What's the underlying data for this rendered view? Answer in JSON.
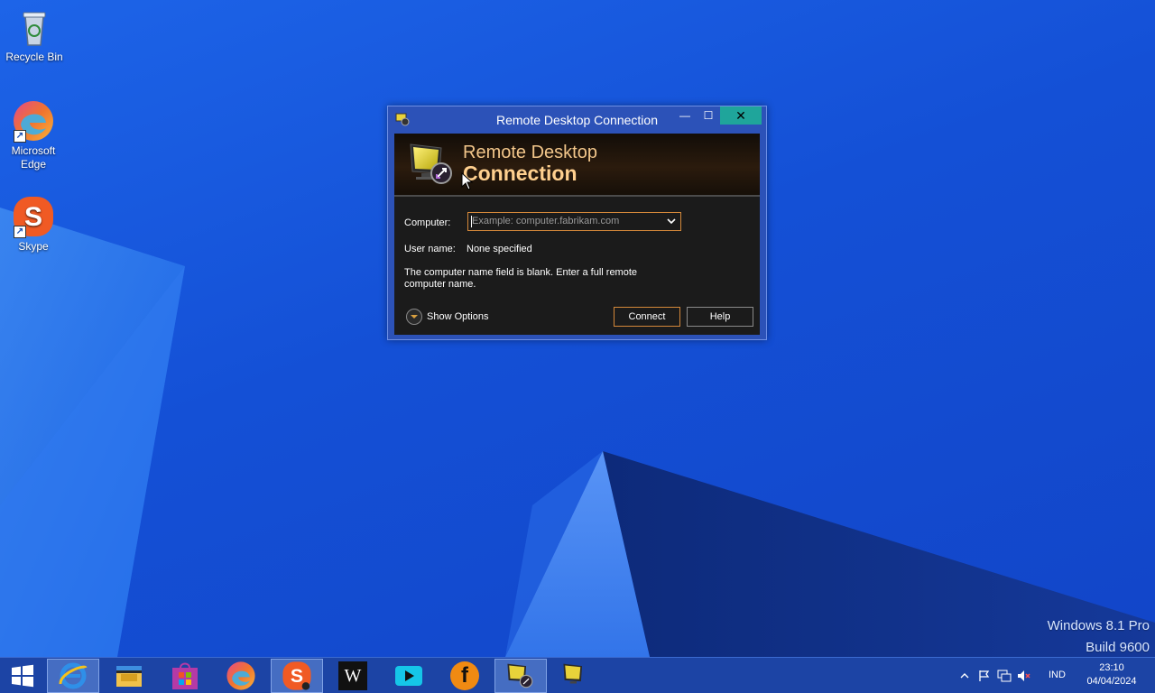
{
  "desktop": {
    "icons": [
      {
        "label": "Recycle Bin",
        "icon": "recycle-bin-icon"
      },
      {
        "label": "Microsoft Edge",
        "icon": "edge-icon"
      },
      {
        "label": "Skype",
        "icon": "skype-icon"
      }
    ],
    "watermark": {
      "line1": "Windows 8.1 Pro",
      "line2": "Build 9600"
    }
  },
  "window": {
    "title": "Remote Desktop Connection",
    "banner_line1": "Remote Desktop",
    "banner_line2": "Connection",
    "computer_label": "Computer:",
    "computer_placeholder": "Example: computer.fabrikam.com",
    "username_label": "User name:",
    "username_value": "None specified",
    "message": "The computer name field is blank. Enter a full remote computer name.",
    "show_options": "Show Options",
    "connect_button": "Connect",
    "help_button": "Help",
    "minimize_glyph": "—",
    "maximize_glyph": "☐",
    "close_glyph": "✕"
  },
  "taskbar": {
    "apps": [
      {
        "name": "Internet Explorer",
        "icon": "internet-explorer-icon"
      },
      {
        "name": "File Explorer",
        "icon": "file-explorer-icon"
      },
      {
        "name": "Store",
        "icon": "store-icon"
      },
      {
        "name": "Microsoft Edge",
        "icon": "edge-icon"
      },
      {
        "name": "Skype",
        "icon": "skype-icon"
      },
      {
        "name": "Wikipedia",
        "icon": "wikipedia-icon",
        "glyph": "W"
      },
      {
        "name": "YouTube",
        "icon": "youtube-icon"
      },
      {
        "name": "Facebook",
        "icon": "facebook-icon",
        "glyph": "f"
      },
      {
        "name": "Remote Desktop Connection",
        "icon": "remote-desktop-icon"
      },
      {
        "name": "Remote Desktop",
        "icon": "remote-desktop-icon-2"
      }
    ],
    "tray": {
      "language": "IND",
      "time": "23:10",
      "date": "04/04/2024"
    },
    "colors": {
      "accent": "#1fa59b",
      "focus": "#d4883a"
    }
  }
}
